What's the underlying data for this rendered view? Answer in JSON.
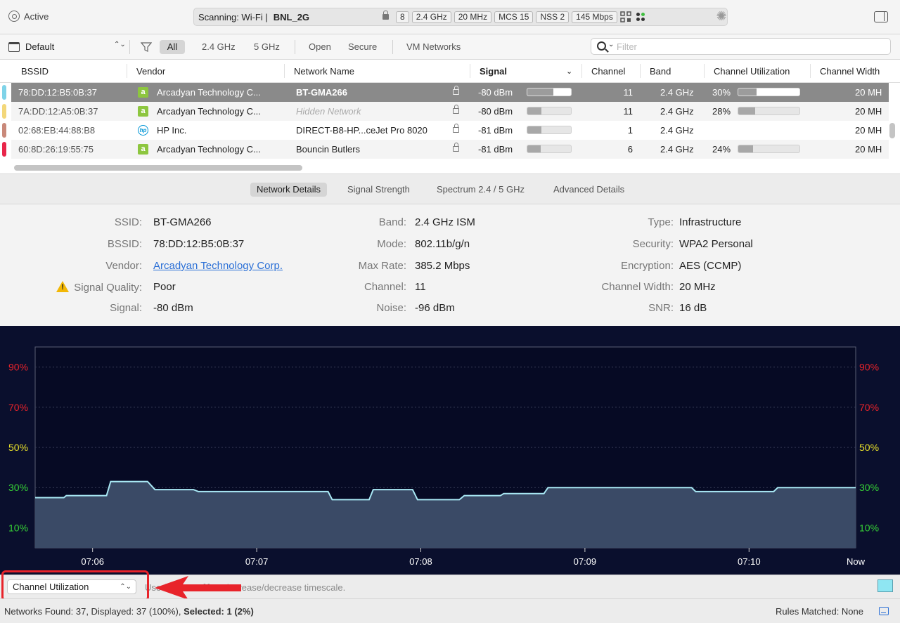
{
  "topbar": {
    "active_label": "Active",
    "scan_label": "Scanning: Wi-Fi  |",
    "ssid": "BNL_2G",
    "pills": [
      "8",
      "2.4 GHz",
      "20 MHz",
      "MCS 15",
      "NSS 2",
      "145 Mbps"
    ]
  },
  "filterbar": {
    "preset": "Default",
    "filters": [
      "All",
      "2.4 GHz",
      "5 GHz",
      "Open",
      "Secure",
      "VM Networks"
    ],
    "active_filter": "All",
    "search_placeholder": "Filter"
  },
  "table": {
    "columns": [
      "BSSID",
      "Vendor",
      "Network Name",
      "Signal",
      "Channel",
      "Band",
      "Channel Utilization",
      "Channel Width"
    ],
    "rows": [
      {
        "bssid": "78:DD:12:B5:0B:37",
        "vendor": "Arcadyan Technology C...",
        "vendor_icon": "arcadyan-logo",
        "name": "BT-GMA266",
        "hidden": false,
        "signal": "-80 dBm",
        "signal_level": 0.6,
        "channel": "11",
        "band": "2.4 GHz",
        "util": "30%",
        "util_level": 0.3,
        "width": "20 MH",
        "stripe": "#7fd3e8",
        "selected": true
      },
      {
        "bssid": "7A:DD:12:A5:0B:37",
        "vendor": "Arcadyan Technology C...",
        "vendor_icon": "arcadyan-logo",
        "name": "Hidden Network",
        "hidden": true,
        "signal": "-80 dBm",
        "signal_level": 0.33,
        "channel": "11",
        "band": "2.4 GHz",
        "util": "28%",
        "util_level": 0.28,
        "width": "20 MH",
        "stripe": "#f3d77a",
        "selected": false
      },
      {
        "bssid": "02:68:EB:44:88:B8",
        "vendor": "HP Inc.",
        "vendor_icon": "hp-logo",
        "name": "DIRECT-B8-HP...ceJet Pro 8020",
        "hidden": false,
        "signal": "-81 dBm",
        "signal_level": 0.33,
        "channel": "1",
        "band": "2.4 GHz",
        "util": "",
        "util_level": null,
        "width": "20 MH",
        "stripe": "#c9897a",
        "selected": false
      },
      {
        "bssid": "60:8D:26:19:55:75",
        "vendor": "Arcadyan Technology C...",
        "vendor_icon": "arcadyan-logo",
        "name": "Bouncin Butlers",
        "hidden": false,
        "signal": "-81 dBm",
        "signal_level": 0.3,
        "channel": "6",
        "band": "2.4 GHz",
        "util": "24%",
        "util_level": 0.24,
        "width": "20 MH",
        "stripe": "#e8264a",
        "selected": false
      }
    ]
  },
  "tabs": [
    "Network Details",
    "Signal Strength",
    "Spectrum 2.4 / 5 GHz",
    "Advanced Details"
  ],
  "active_tab": "Network Details",
  "details": {
    "col1": [
      {
        "label": "SSID:",
        "value": "BT-GMA266"
      },
      {
        "label": "BSSID:",
        "value": "78:DD:12:B5:0B:37"
      },
      {
        "label": "Vendor:",
        "value": "Arcadyan Technology Corp."
      },
      {
        "label": "Signal Quality:",
        "value": "Poor"
      },
      {
        "label": "Signal:",
        "value": "-80 dBm"
      }
    ],
    "col2": [
      {
        "label": "Band:",
        "value": "2.4 GHz ISM"
      },
      {
        "label": "Mode:",
        "value": "802.11b/g/n"
      },
      {
        "label": "Max Rate:",
        "value": "385.2 Mbps"
      },
      {
        "label": "Channel:",
        "value": "11"
      },
      {
        "label": "Noise:",
        "value": "-96 dBm"
      }
    ],
    "col3": [
      {
        "label": "Type:",
        "value": "Infrastructure"
      },
      {
        "label": "Security:",
        "value": "WPA2 Personal"
      },
      {
        "label": "Encryption:",
        "value": "AES (CCMP)"
      },
      {
        "label": "Channel Width:",
        "value": "20 MHz"
      },
      {
        "label": "SNR:",
        "value": "16 dB"
      }
    ]
  },
  "chart_data": {
    "type": "area",
    "title": "",
    "xlabel": "",
    "ylabel": "",
    "ylim": [
      0,
      100
    ],
    "y_ticks": [
      {
        "label": "90%",
        "value": 90,
        "color": "#e8232a"
      },
      {
        "label": "70%",
        "value": 70,
        "color": "#e8232a"
      },
      {
        "label": "50%",
        "value": 50,
        "color": "#e8e02a"
      },
      {
        "label": "30%",
        "value": 30,
        "color": "#36d236"
      },
      {
        "label": "10%",
        "value": 10,
        "color": "#36d236"
      }
    ],
    "x_ticks": [
      "07:06",
      "07:07",
      "07:08",
      "07:09",
      "07:10",
      "Now"
    ],
    "series": [
      {
        "color": "#a8e8f4",
        "fill": "#3a4a66",
        "points": [
          [
            0,
            25
          ],
          [
            0.035,
            25
          ],
          [
            0.038,
            26
          ],
          [
            0.087,
            26
          ],
          [
            0.092,
            33
          ],
          [
            0.137,
            33
          ],
          [
            0.146,
            29
          ],
          [
            0.193,
            29
          ],
          [
            0.199,
            28
          ],
          [
            0.357,
            28
          ],
          [
            0.362,
            24
          ],
          [
            0.407,
            24
          ],
          [
            0.412,
            29
          ],
          [
            0.46,
            29
          ],
          [
            0.466,
            24
          ],
          [
            0.517,
            24
          ],
          [
            0.523,
            26
          ],
          [
            0.567,
            26
          ],
          [
            0.571,
            27
          ],
          [
            0.62,
            27
          ],
          [
            0.625,
            30
          ],
          [
            0.8,
            30
          ],
          [
            0.805,
            28
          ],
          [
            0.9,
            28
          ],
          [
            0.905,
            30
          ],
          [
            1.0,
            30
          ]
        ]
      }
    ]
  },
  "statusbar": {
    "graph_select": "Channel Utilization",
    "hint": "Use ⌘-, or ⌥⌘- to increase/decrease timescale."
  },
  "footer": {
    "left": "Networks Found: 37, Displayed: 37 (100%), ",
    "left_bold": "Selected: 1 (2%)",
    "right": "Rules Matched: None"
  }
}
